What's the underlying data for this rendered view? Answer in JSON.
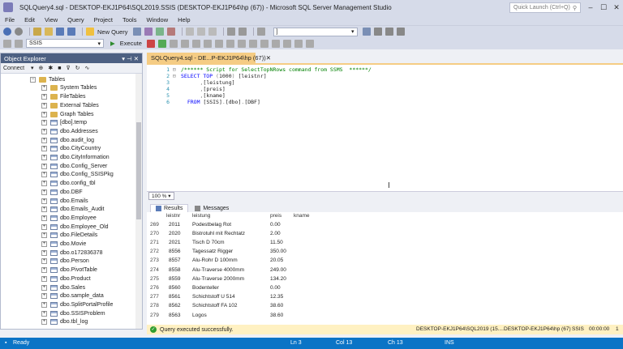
{
  "window": {
    "title": "SQLQuery4.sql - DESKTOP-EKJ1P64\\SQL2019.SSIS (DESKTOP-EKJ1P64\\hp (67)) - Microsoft SQL Server Management Studio",
    "quick_launch_placeholder": "Quick Launch (Ctrl+Q)"
  },
  "menu": [
    "File",
    "Edit",
    "View",
    "Query",
    "Project",
    "Tools",
    "Window",
    "Help"
  ],
  "toolbar": {
    "new_query": "New Query",
    "database": "SSIS",
    "execute": "Execute",
    "search_combo": "]"
  },
  "object_explorer": {
    "title": "Object Explorer",
    "connect": "Connect",
    "items": [
      {
        "label": "Tables",
        "type": "folder",
        "exp": "−",
        "indent": 0
      },
      {
        "label": "System Tables",
        "type": "folder",
        "exp": "+",
        "indent": 1
      },
      {
        "label": "FileTables",
        "type": "folder",
        "exp": "+",
        "indent": 1
      },
      {
        "label": "External Tables",
        "type": "folder",
        "exp": "+",
        "indent": 1
      },
      {
        "label": "Graph Tables",
        "type": "folder",
        "exp": "+",
        "indent": 1
      },
      {
        "label": "[dbo].temp",
        "type": "table",
        "exp": "+",
        "indent": 1
      },
      {
        "label": "dbo.Addresses",
        "type": "table",
        "exp": "+",
        "indent": 1
      },
      {
        "label": "dbo.audit_log",
        "type": "table",
        "exp": "+",
        "indent": 1
      },
      {
        "label": "dbo.CityCountry",
        "type": "table",
        "exp": "+",
        "indent": 1
      },
      {
        "label": "dbo.CityInformation",
        "type": "table",
        "exp": "+",
        "indent": 1
      },
      {
        "label": "dbo.Config_Server",
        "type": "table",
        "exp": "+",
        "indent": 1
      },
      {
        "label": "dbo.Config_SSISPkg",
        "type": "table",
        "exp": "+",
        "indent": 1
      },
      {
        "label": "dbo.config_tbl",
        "type": "table",
        "exp": "+",
        "indent": 1
      },
      {
        "label": "dbo.DBF",
        "type": "table",
        "exp": "+",
        "indent": 1
      },
      {
        "label": "dbo.Emails",
        "type": "table",
        "exp": "+",
        "indent": 1
      },
      {
        "label": "dbo.Emails_Audit",
        "type": "table",
        "exp": "+",
        "indent": 1
      },
      {
        "label": "dbo.Employee",
        "type": "table",
        "exp": "+",
        "indent": 1
      },
      {
        "label": "dbo.Employee_Old",
        "type": "table",
        "exp": "+",
        "indent": 1
      },
      {
        "label": "dbo.FileDetails",
        "type": "table",
        "exp": "+",
        "indent": 1
      },
      {
        "label": "dbo.Movie",
        "type": "table",
        "exp": "+",
        "indent": 1
      },
      {
        "label": "dbo.o172836378",
        "type": "table",
        "exp": "+",
        "indent": 1
      },
      {
        "label": "dbo.Person",
        "type": "table",
        "exp": "+",
        "indent": 1
      },
      {
        "label": "dbo.PivotTable",
        "type": "table",
        "exp": "+",
        "indent": 1
      },
      {
        "label": "dbo.Product",
        "type": "table",
        "exp": "+",
        "indent": 1
      },
      {
        "label": "dbo.Sales",
        "type": "table",
        "exp": "+",
        "indent": 1
      },
      {
        "label": "dbo.sample_data",
        "type": "table",
        "exp": "+",
        "indent": 1
      },
      {
        "label": "dbo.SplitPortalProfile",
        "type": "table",
        "exp": "+",
        "indent": 1
      },
      {
        "label": "dbo.SSISProblem",
        "type": "table",
        "exp": "+",
        "indent": 1
      },
      {
        "label": "dbo.tbl_log",
        "type": "table",
        "exp": "+",
        "indent": 1
      }
    ]
  },
  "editor": {
    "tab_label": "SQLQuery4.sql - DE...P-EKJ1P64\\hp (67))",
    "lines": [
      {
        "n": "1",
        "fold": "⊟",
        "parts": [
          {
            "c": "cm",
            "t": "/****** Script for SelectTopNRows command from SSMS  ******/"
          }
        ]
      },
      {
        "n": "2",
        "fold": "⊟",
        "parts": [
          {
            "c": "kw",
            "t": "SELECT TOP "
          },
          {
            "c": "gr",
            "t": "("
          },
          {
            "c": "",
            "t": "1000"
          },
          {
            "c": "gr",
            "t": ") "
          },
          {
            "c": "",
            "t": "[leistnr]"
          }
        ]
      },
      {
        "n": "3",
        "fold": "",
        "parts": [
          {
            "c": "",
            "t": "      "
          },
          {
            "c": "gr",
            "t": ","
          },
          {
            "c": "",
            "t": "[leistung]"
          }
        ]
      },
      {
        "n": "4",
        "fold": "",
        "parts": [
          {
            "c": "",
            "t": "      "
          },
          {
            "c": "gr",
            "t": ","
          },
          {
            "c": "",
            "t": "[preis]"
          }
        ]
      },
      {
        "n": "5",
        "fold": "",
        "parts": [
          {
            "c": "",
            "t": "      "
          },
          {
            "c": "gr",
            "t": ","
          },
          {
            "c": "",
            "t": "[kname]"
          }
        ]
      },
      {
        "n": "6",
        "fold": "",
        "parts": [
          {
            "c": "",
            "t": "  "
          },
          {
            "c": "kw",
            "t": "FROM "
          },
          {
            "c": "",
            "t": "[SSIS]"
          },
          {
            "c": "gr",
            "t": "."
          },
          {
            "c": "",
            "t": "[dbo]"
          },
          {
            "c": "gr",
            "t": "."
          },
          {
            "c": "",
            "t": "[DBF]"
          }
        ]
      }
    ]
  },
  "zoom": "100 %",
  "results": {
    "tabs": [
      "Results",
      "Messages"
    ],
    "columns": [
      "leistnr",
      "leistung",
      "preis",
      "kname"
    ],
    "rows": [
      [
        "269",
        "2011",
        "Podestbelag Rot",
        "0.00",
        ""
      ],
      [
        "270",
        "2020",
        "Bistrotuhl mit Rechtatz",
        "2.00",
        ""
      ],
      [
        "271",
        "2021",
        "Tisch D 70cm",
        "11.50",
        ""
      ],
      [
        "272",
        "8556",
        "Tagessatz Rigger",
        "350.00",
        ""
      ],
      [
        "273",
        "8557",
        "Alu-Rohr D 100mm",
        "20.05",
        ""
      ],
      [
        "274",
        "8558",
        "Alu-Traverse 4000mm",
        "249.00",
        ""
      ],
      [
        "275",
        "8559",
        "Alu-Traverse 2000mm",
        "134.20",
        ""
      ],
      [
        "276",
        "8560",
        "Bodenteller",
        "0.00",
        ""
      ],
      [
        "277",
        "8561",
        "Schichtstoff U 514",
        "12.35",
        ""
      ],
      [
        "278",
        "8562",
        "Schichtstoff FA 102",
        "38.60",
        ""
      ],
      [
        "279",
        "8563",
        "Logos",
        "38.60",
        ""
      ]
    ]
  },
  "query_status": {
    "message": "Query executed successfully.",
    "server": "DESKTOP-EKJ1P64\\SQL2019 (15....",
    "user": "DESKTOP-EKJ1P64\\hp (67)",
    "database": "SSIS",
    "time": "00:00:00",
    "rows": "1"
  },
  "status": {
    "ready": "Ready",
    "line": "Ln 3",
    "col": "Col 13",
    "ch": "Ch 13",
    "mode": "INS"
  },
  "colors": {
    "accent": "#0b74c6",
    "tab_active": "#f5cc84",
    "oe_header": "#4d6082"
  }
}
